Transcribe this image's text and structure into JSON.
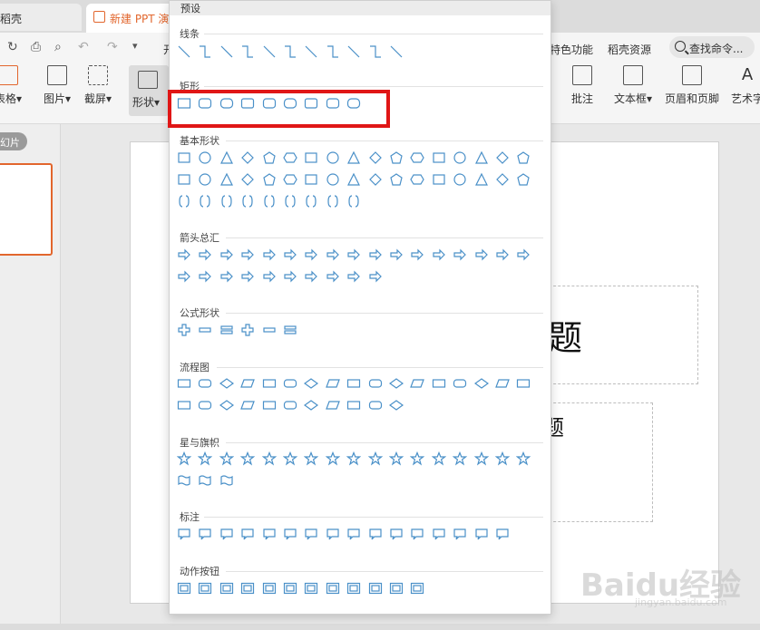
{
  "tabs": {
    "first": "稻壳",
    "second": "新建 PPT 演"
  },
  "ribbon": {
    "menu_partial": "开",
    "features": "特色功能",
    "docer": "稻壳资源",
    "search_placeholder": "查找命令...",
    "buttons": {
      "table": "表格",
      "picture": "图片",
      "screenshot": "截屏",
      "shape": "形状",
      "comment": "批注",
      "textbox": "文本框",
      "header_footer": "页眉和页脚",
      "art": "艺术字"
    }
  },
  "left_panel": {
    "slides_label": "幻片"
  },
  "slide": {
    "title_fragment": "题",
    "subtitle_fragment": "题"
  },
  "watermark": {
    "brand": "Baidu经验",
    "url": "jingyan.baidu.com"
  },
  "dropdown": {
    "header": "预设",
    "sections": {
      "lines": "线条",
      "rect": "矩形",
      "basic": "基本形状",
      "arrows": "箭头总汇",
      "equation": "公式形状",
      "flowchart": "流程图",
      "stars": "星与旗帜",
      "callouts": "标注",
      "action": "动作按钮"
    }
  },
  "colors": {
    "accent": "#e2662d",
    "icon_stroke": "#4a90c8",
    "highlight": "#e01616"
  }
}
